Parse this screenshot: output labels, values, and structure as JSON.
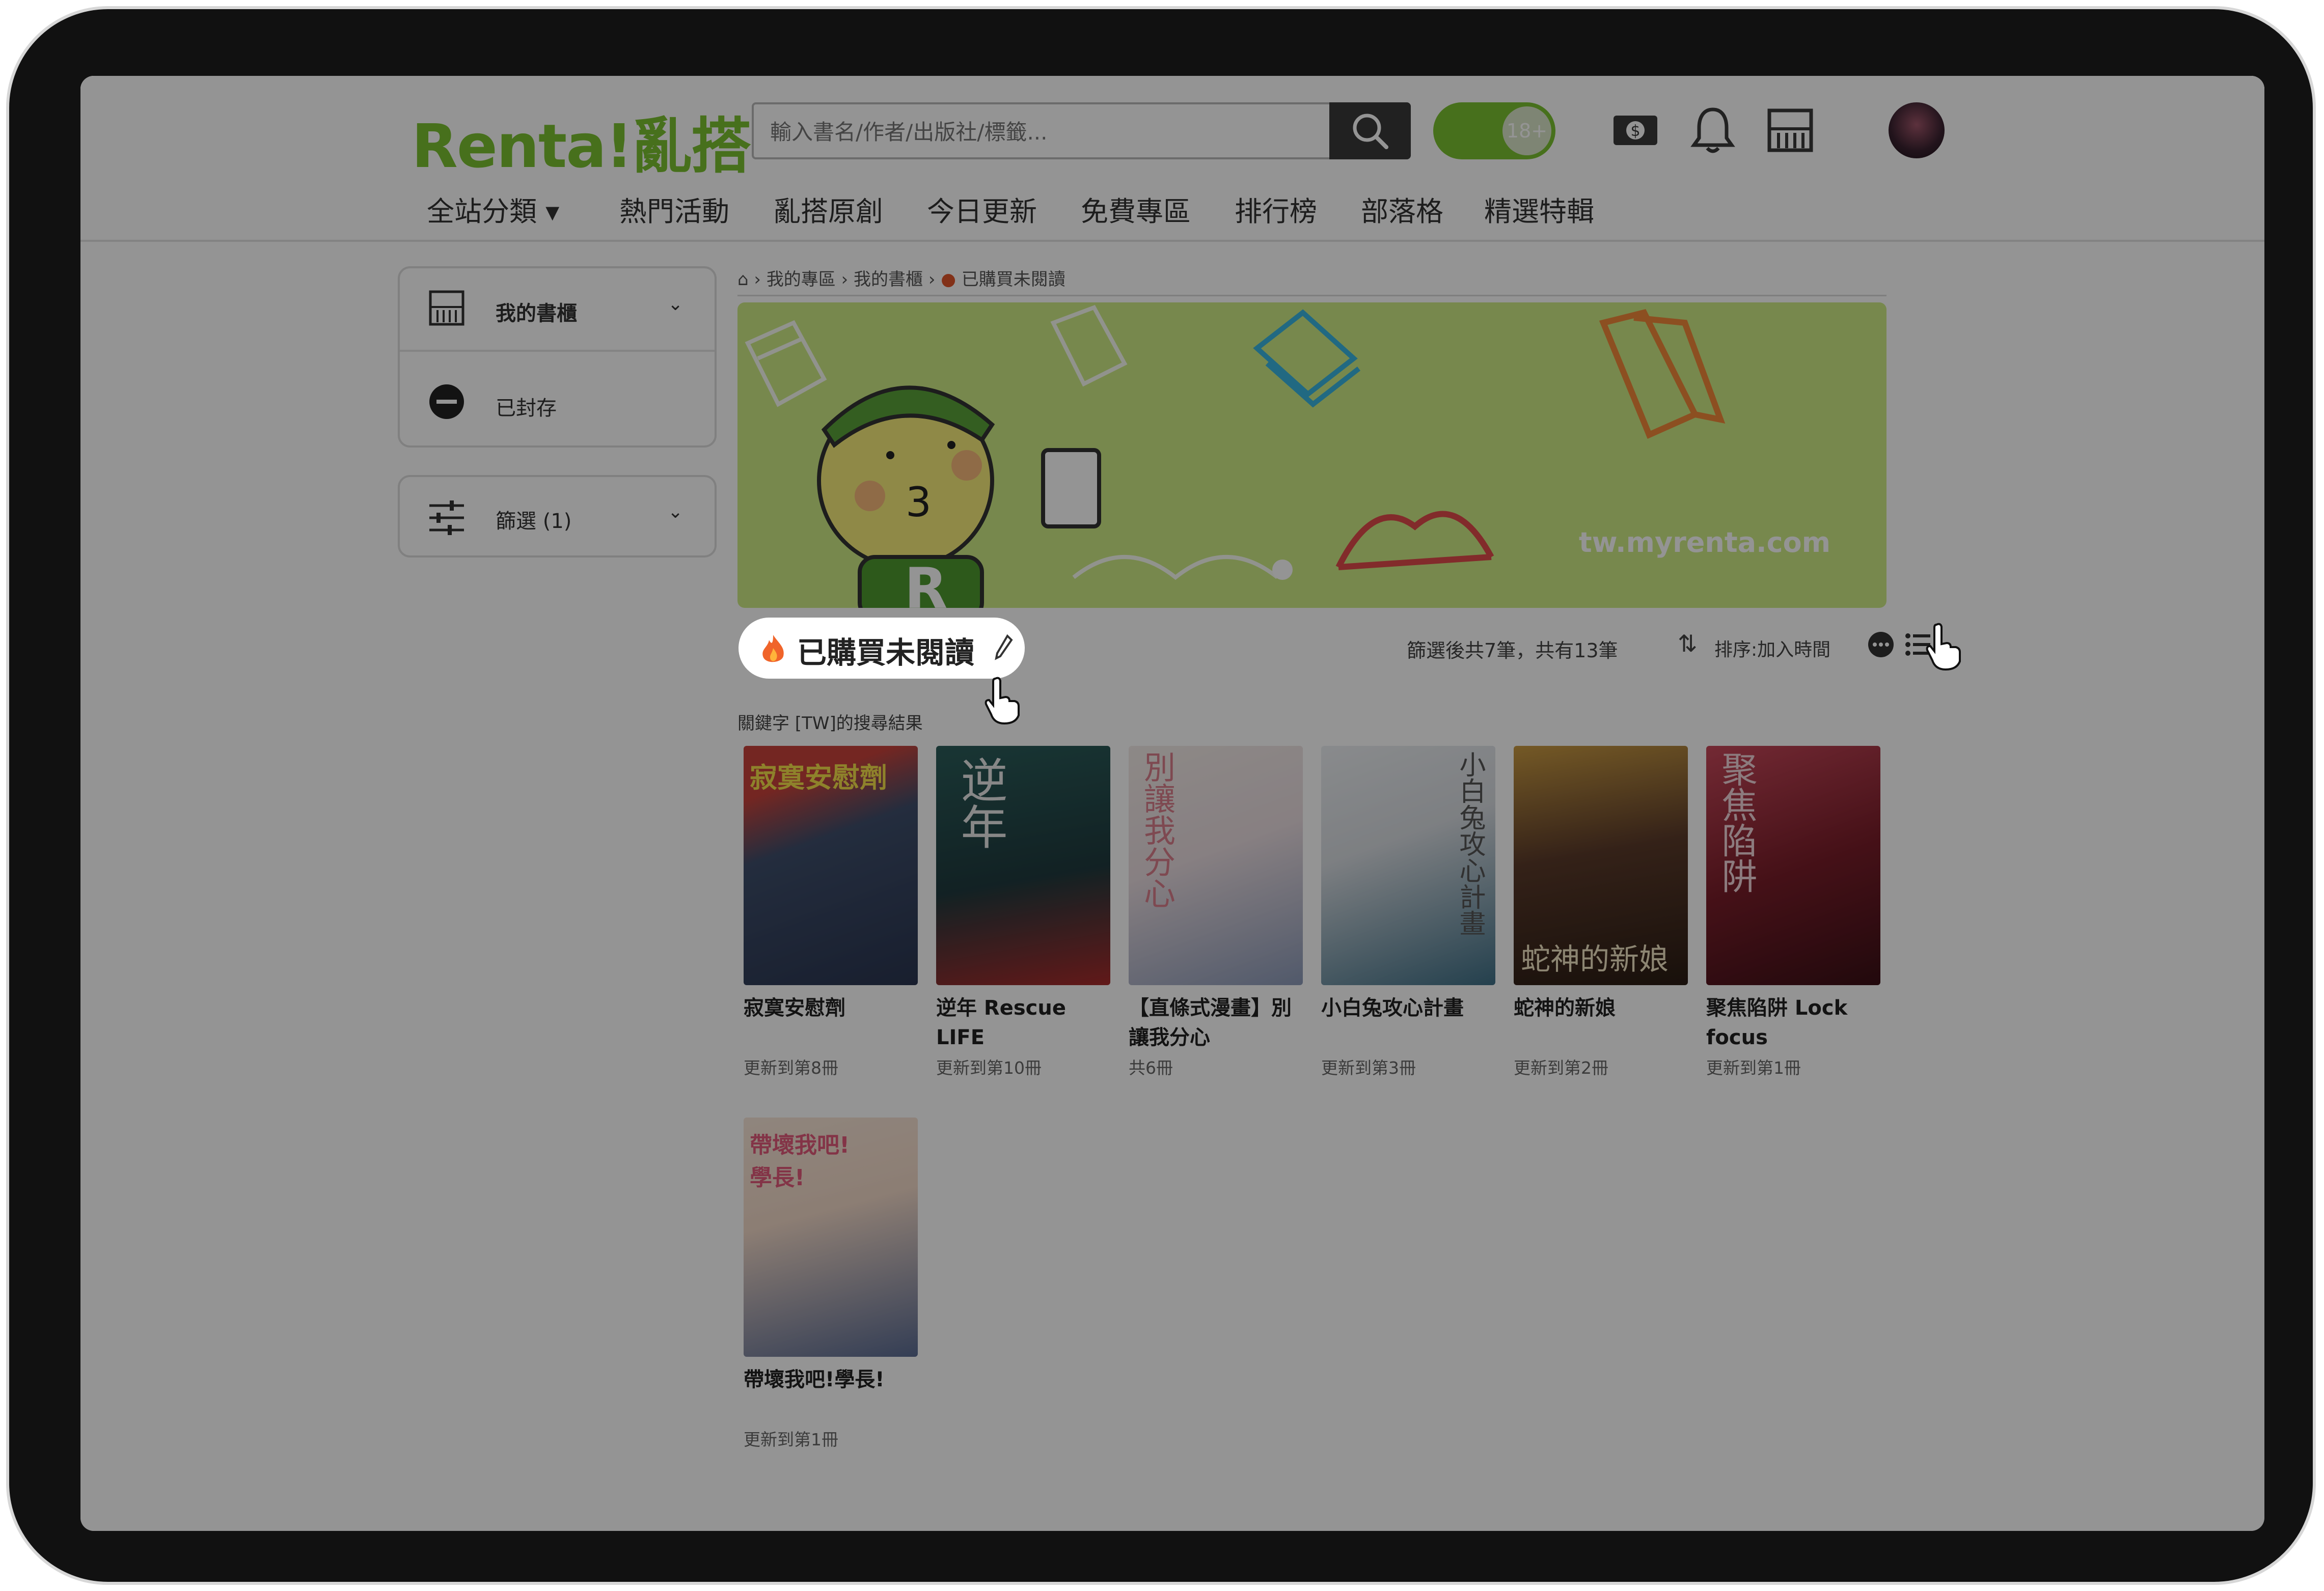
{
  "header": {
    "logo_text": "Renta!亂搭",
    "search_placeholder": "輸入書名/作者/出版社/標籤...",
    "age_toggle_label": "18+",
    "nav_items": [
      "全站分類 ▾",
      "熱門活動",
      "亂搭原創",
      "今日更新",
      "免費專區",
      "排行榜",
      "部落格",
      "精選特輯"
    ]
  },
  "sidebar": {
    "bookshelf_label": "我的書櫃",
    "archived_label": "已封存",
    "filter_label": "篩選 (1)"
  },
  "breadcrumb": [
    "我的專區",
    "我的書櫃",
    "已購買未閱讀"
  ],
  "banner": {
    "site_text": "tw.myrenta.com"
  },
  "list": {
    "title": "已購買未閱讀",
    "keyword_note": "關鍵字 [TW]的搜尋結果",
    "count_text": "篩選後共7筆，共有13筆",
    "sort_text": "排序:加入時間"
  },
  "books": [
    {
      "title": "寂寞安慰劑",
      "sub": "更新到第8冊",
      "cover_text": "寂寞安慰劑",
      "c1": "#3e4e6b",
      "c2": "#c9433b"
    },
    {
      "title": "逆年 Rescue LIFE",
      "sub": "更新到第10冊",
      "cover_text": "逆年",
      "c1": "#2b5d5a",
      "c2": "#a82b2b"
    },
    {
      "title": "【直條式漫畫】別讓我分心",
      "sub": "共6冊",
      "cover_text": "別讓我分心",
      "c1": "#e9dce0",
      "c2": "#8c9ab8"
    },
    {
      "title": "小白兔攻心計畫",
      "sub": "更新到第3冊",
      "cover_text": "小白兔攻心計畫",
      "c1": "#d7dbe0",
      "c2": "#3f6f86"
    },
    {
      "title": "蛇神的新娘",
      "sub": "更新到第2冊",
      "cover_text": "蛇神的新娘",
      "c1": "#5a3a2a",
      "c2": "#c99a42"
    },
    {
      "title": "聚焦陷阱 Lock focus",
      "sub": "更新到第1冊",
      "cover_text": "聚焦陷阱",
      "c1": "#7a1e2a",
      "c2": "#c7485a"
    },
    {
      "title": "帶壞我吧!學長!",
      "sub": "更新到第1冊",
      "cover_text": "帶壞我吧!學長!",
      "c1": "#f2d9c8",
      "c2": "#5a6b92"
    }
  ]
}
